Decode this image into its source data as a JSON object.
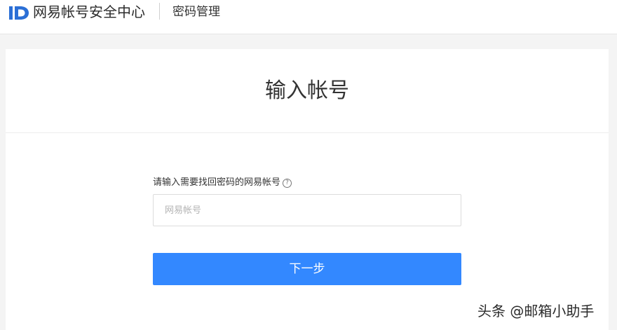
{
  "header": {
    "logo_icon": "netease-id-logo-icon",
    "brand_name": "网易帐号安全中心",
    "section_title": "密码管理"
  },
  "main": {
    "title": "输入帐号",
    "field_label": "请输入需要找回密码的网易帐号",
    "help_icon": "question-circle-icon",
    "account_input": {
      "value": "",
      "placeholder": "网易帐号"
    },
    "next_button_label": "下一步"
  },
  "watermark": "头条 @邮箱小助手",
  "colors": {
    "primary_button": "#3388ff",
    "logo": "#2b6fd6",
    "page_background": "#f4f4f4"
  }
}
